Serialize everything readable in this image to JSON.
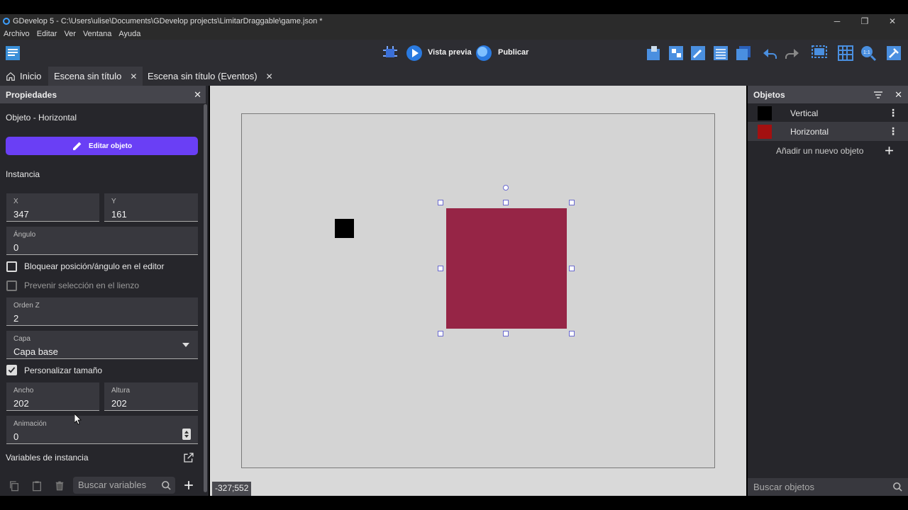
{
  "window": {
    "title": "GDevelop 5 - C:\\Users\\ulise\\Documents\\GDevelop projects\\LimitarDraggable\\game.json *",
    "minimize": "─",
    "restore": "❐",
    "close": "✕"
  },
  "menu": [
    "Archivo",
    "Editar",
    "Ver",
    "Ventana",
    "Ayuda"
  ],
  "toolbar": {
    "preview_label": "Vista previa",
    "publish_label": "Publicar"
  },
  "tabs": [
    {
      "label": "Inicio"
    },
    {
      "label": "Escena sin título"
    },
    {
      "label": "Escena sin título (Eventos)"
    }
  ],
  "properties": {
    "title": "Propiedades",
    "object_line": "Objeto  - Horizontal",
    "edit_button": "Editar objeto",
    "instance_heading": "Instancia",
    "x_label": "X",
    "x_value": "347",
    "y_label": "Y",
    "y_value": "161",
    "angle_label": "Ángulo",
    "angle_value": "0",
    "lock_label": "Bloquear posición/ángulo en el editor",
    "prevent_label": "Prevenir selección en el lienzo",
    "z_label": "Orden Z",
    "z_value": "2",
    "layer_label": "Capa",
    "layer_value": "Capa base",
    "custom_size_label": "Personalizar tamaño",
    "width_label": "Ancho",
    "width_value": "202",
    "height_label": "Altura",
    "height_value": "202",
    "anim_label": "Animación",
    "anim_value": "0",
    "vars_heading": "Variables de instancia",
    "search_vars_placeholder": "Buscar variables"
  },
  "canvas": {
    "coords": "-327;552",
    "selected_color": "#962546"
  },
  "objects": {
    "title": "Objetos",
    "items": [
      {
        "name": "Vertical",
        "color": "#000000"
      },
      {
        "name": "Horizontal",
        "color": "#a31010"
      }
    ],
    "add_label": "Añadir un nuevo objeto",
    "search_placeholder": "Buscar objetos"
  }
}
